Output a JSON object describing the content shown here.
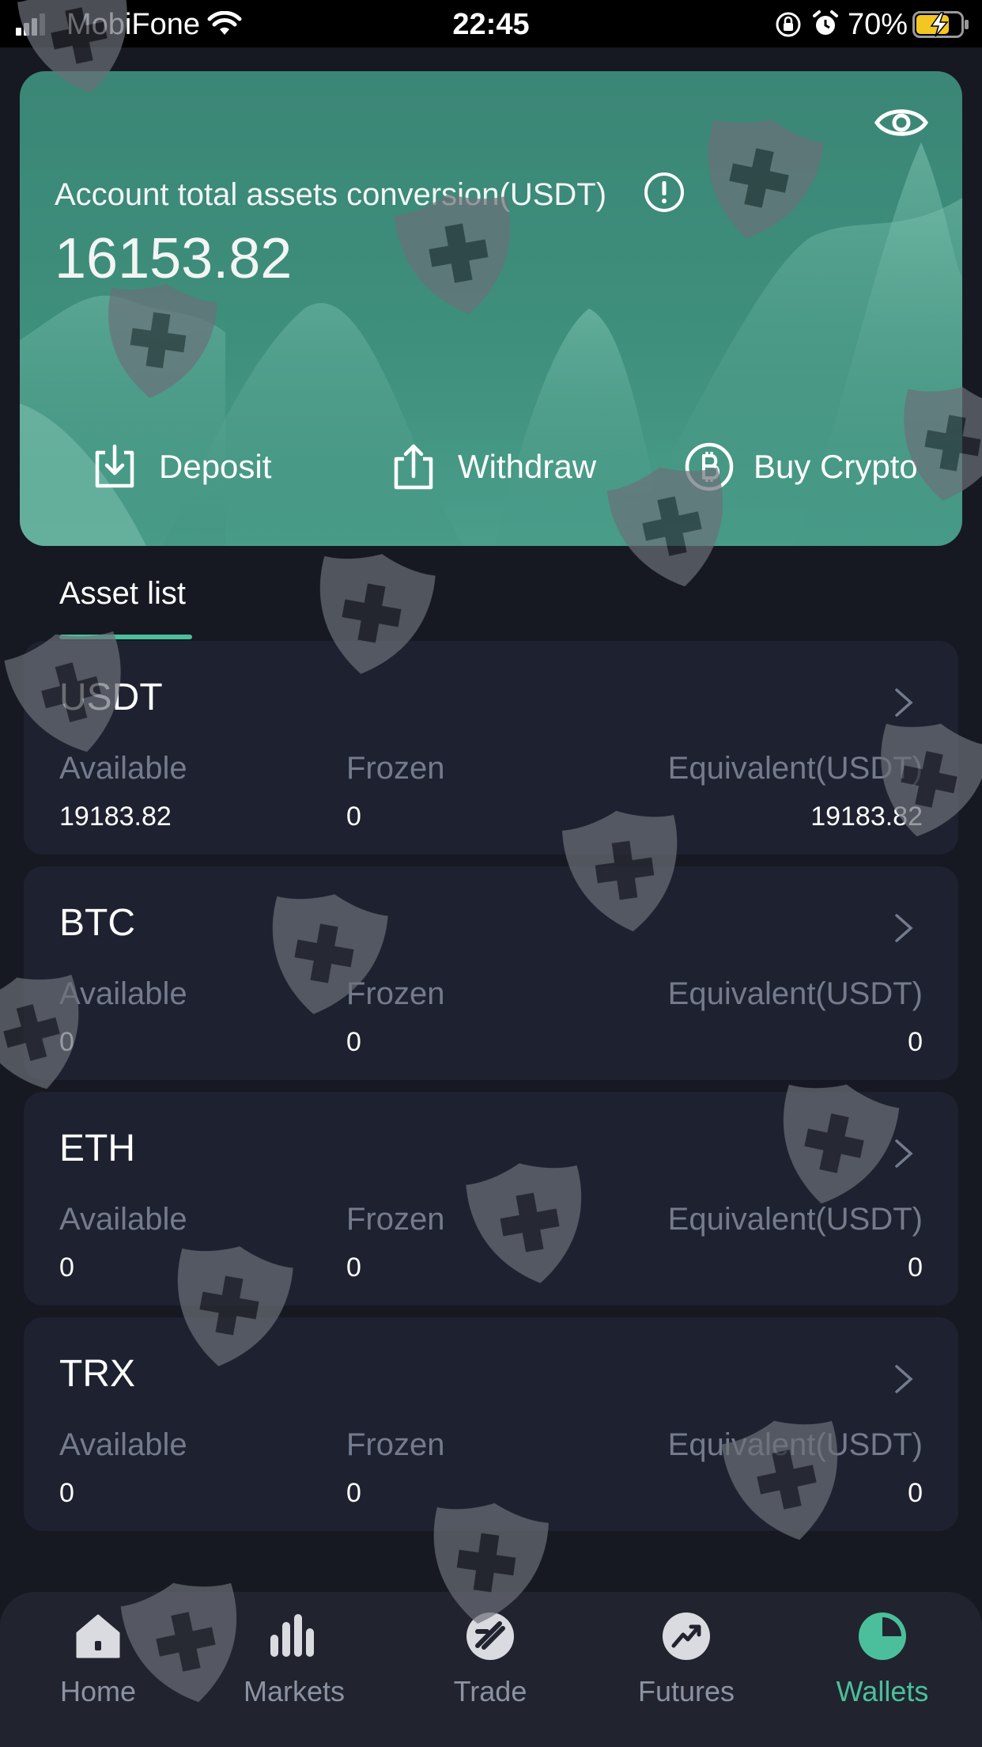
{
  "status_bar": {
    "carrier": "MobiFone",
    "time": "22:45",
    "battery": "70%"
  },
  "account": {
    "total_label": "Account total assets conversion(USDT)",
    "total_value": "16153.82",
    "actions": {
      "deposit": "Deposit",
      "withdraw": "Withdraw",
      "buy_crypto": "Buy Crypto"
    }
  },
  "asset_tab": "Asset list",
  "assets": [
    {
      "symbol": "USDT",
      "available_label": "Available",
      "frozen_label": "Frozen",
      "equivalent_label": "Equivalent(USDT)",
      "available": "19183.82",
      "frozen": "0",
      "equivalent": "19183.82"
    },
    {
      "symbol": "BTC",
      "available_label": "Available",
      "frozen_label": "Frozen",
      "equivalent_label": "Equivalent(USDT)",
      "available": "0",
      "frozen": "0",
      "equivalent": "0"
    },
    {
      "symbol": "ETH",
      "available_label": "Available",
      "frozen_label": "Frozen",
      "equivalent_label": "Equivalent(USDT)",
      "available": "0",
      "frozen": "0",
      "equivalent": "0"
    },
    {
      "symbol": "TRX",
      "available_label": "Available",
      "frozen_label": "Frozen",
      "equivalent_label": "Equivalent(USDT)",
      "available": "0",
      "frozen": "0",
      "equivalent": "0"
    }
  ],
  "nav": {
    "items": [
      {
        "label": "Home",
        "icon": "home-icon"
      },
      {
        "label": "Markets",
        "icon": "bar-chart-icon"
      },
      {
        "label": "Trade",
        "icon": "trade-icon"
      },
      {
        "label": "Futures",
        "icon": "trend-up-icon"
      },
      {
        "label": "Wallets",
        "icon": "pie-chart-icon"
      }
    ],
    "active": "Wallets"
  },
  "colors": {
    "background": "#161922",
    "card": "#1e2130",
    "hero": "#3e8f7c",
    "accent": "#4bbf9c",
    "muted_text": "#737b8d",
    "nav_background": "#21242f"
  }
}
